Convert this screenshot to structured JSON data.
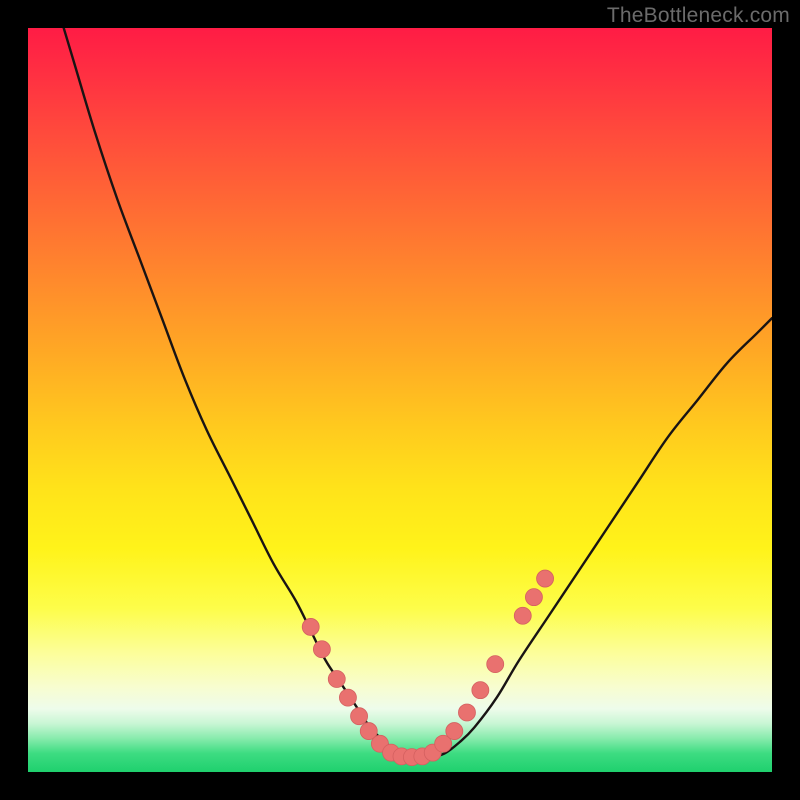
{
  "watermark": {
    "text": "TheBottleneck.com"
  },
  "colors": {
    "frame_bg": "#000000",
    "curve": "#191414",
    "marker_fill": "#e9716f",
    "marker_stroke": "#d46060",
    "gradient_stops": [
      "#ff1c45",
      "#ff8a2c",
      "#ffe31a",
      "#fcfe9a",
      "#1fd06e"
    ]
  },
  "chart_data": {
    "type": "line",
    "title": "",
    "xlabel": "",
    "ylabel": "",
    "xlim": [
      0,
      100
    ],
    "ylim": [
      0,
      100
    ],
    "grid": false,
    "legend": false,
    "note": "V-shaped bottleneck curve over a vertical heat gradient. Axes are unlabeled; values are estimated from pixel positions on a 0–100 normalized scale (y=0 at bottom). The curve reaches a flat minimum near x≈48–55 at y≈2, rising steeply toward the edges.",
    "series": [
      {
        "name": "bottleneck-curve",
        "x": [
          0,
          3,
          6,
          9,
          12,
          15,
          18,
          21,
          24,
          27,
          30,
          33,
          36,
          38,
          40,
          42,
          44,
          46,
          48,
          50,
          52,
          54,
          56,
          58,
          60,
          63,
          66,
          70,
          74,
          78,
          82,
          86,
          90,
          94,
          98,
          100
        ],
        "y": [
          116,
          106,
          96,
          86,
          77,
          69,
          61,
          53,
          46,
          40,
          34,
          28,
          23,
          19,
          15,
          12,
          9,
          6,
          4,
          2.5,
          2,
          2,
          2.5,
          4,
          6,
          10,
          15,
          21,
          27,
          33,
          39,
          45,
          50,
          55,
          59,
          61
        ]
      }
    ],
    "markers": {
      "name": "sample-points",
      "note": "Salmon-colored circular markers along the lower arms and floor of the curve.",
      "points": [
        {
          "x": 38.0,
          "y": 19.5
        },
        {
          "x": 39.5,
          "y": 16.5
        },
        {
          "x": 41.5,
          "y": 12.5
        },
        {
          "x": 43.0,
          "y": 10.0
        },
        {
          "x": 44.5,
          "y": 7.5
        },
        {
          "x": 45.8,
          "y": 5.5
        },
        {
          "x": 47.3,
          "y": 3.8
        },
        {
          "x": 48.8,
          "y": 2.6
        },
        {
          "x": 50.2,
          "y": 2.1
        },
        {
          "x": 51.6,
          "y": 2.0
        },
        {
          "x": 53.0,
          "y": 2.1
        },
        {
          "x": 54.4,
          "y": 2.6
        },
        {
          "x": 55.8,
          "y": 3.8
        },
        {
          "x": 57.3,
          "y": 5.5
        },
        {
          "x": 59.0,
          "y": 8.0
        },
        {
          "x": 60.8,
          "y": 11.0
        },
        {
          "x": 62.8,
          "y": 14.5
        },
        {
          "x": 66.5,
          "y": 21.0
        },
        {
          "x": 68.0,
          "y": 23.5
        },
        {
          "x": 69.5,
          "y": 26.0
        }
      ]
    }
  }
}
